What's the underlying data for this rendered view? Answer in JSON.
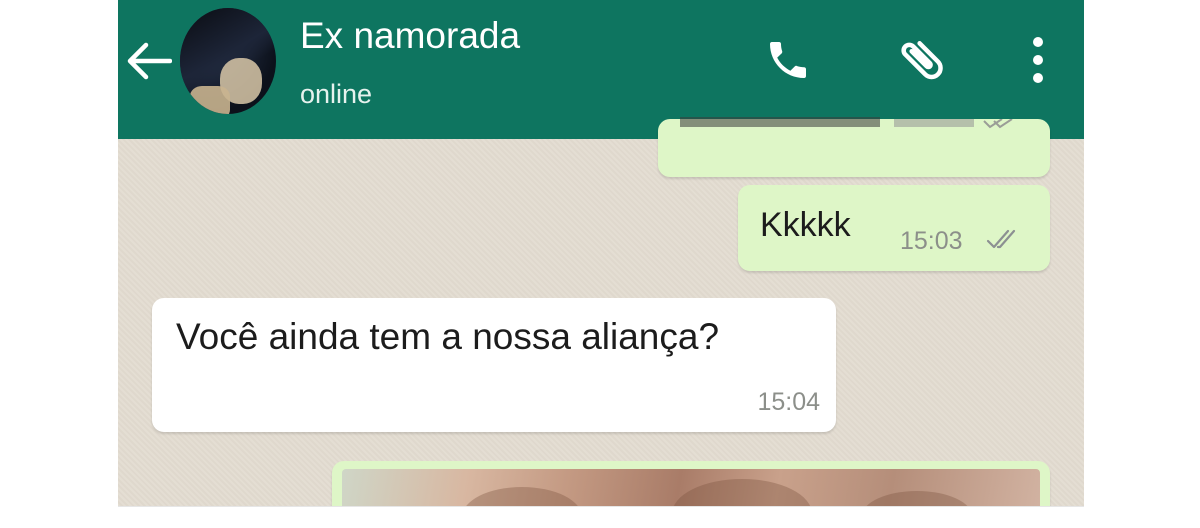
{
  "header": {
    "contact_name": "Ex namorada",
    "status": "online",
    "background_color": "#0e7560",
    "icons": [
      "back-arrow-icon",
      "avatar",
      "phone-icon",
      "paperclip-icon",
      "more-vertical-icon"
    ]
  },
  "messages": [
    {
      "direction": "out",
      "text": "",
      "time": "",
      "partially_visible": true
    },
    {
      "direction": "out",
      "text": "Kkkkk",
      "time": "15:03",
      "status": "read-double-tick"
    },
    {
      "direction": "in",
      "text": "Você ainda tem a nossa aliança?",
      "time": "15:04"
    },
    {
      "direction": "out",
      "type": "image",
      "partially_visible": true
    }
  ],
  "colors": {
    "outgoing_bubble": "#def6c7",
    "incoming_bubble": "#ffffff",
    "chat_background": "#e3dcd1"
  }
}
